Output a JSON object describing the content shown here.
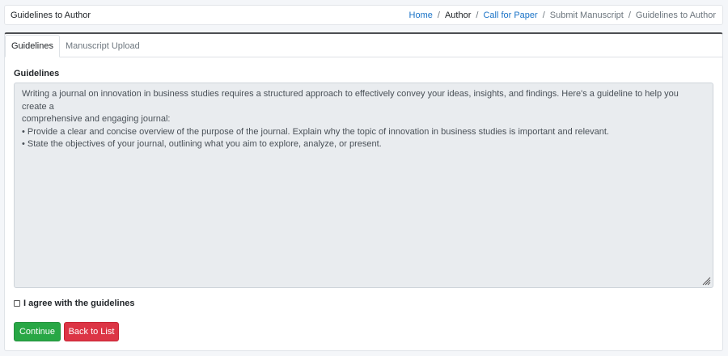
{
  "header": {
    "title": "Guidelines to Author",
    "breadcrumb": [
      {
        "label": "Home"
      },
      {
        "label": "Author"
      },
      {
        "label": "Call for Paper"
      },
      {
        "label": "Submit Manuscript"
      },
      {
        "label": "Guidelines to Author"
      }
    ]
  },
  "tabs": [
    {
      "label": "Guidelines",
      "active": true
    },
    {
      "label": "Manuscript Upload",
      "active": false
    }
  ],
  "guidelines": {
    "heading": "Guidelines",
    "lines": [
      "Writing a journal on innovation in business studies requires a structured approach to effectively convey your ideas, insights, and findings. Here's a guideline to help you create a",
      "comprehensive and engaging journal:",
      "• Provide a clear and concise overview of the purpose of the journal. Explain why the topic of innovation in business studies is important and relevant.",
      "• State the objectives of your journal, outlining what you aim to explore, analyze, or present."
    ]
  },
  "agreement": {
    "label": "I agree with the guidelines",
    "checked": false
  },
  "buttons": {
    "continue": "Continue",
    "back": "Back to List"
  },
  "colors": {
    "link": "#1a73c7",
    "continue": "#28a745",
    "back": "#dc3545",
    "readonly_bg": "#e9ecef"
  }
}
